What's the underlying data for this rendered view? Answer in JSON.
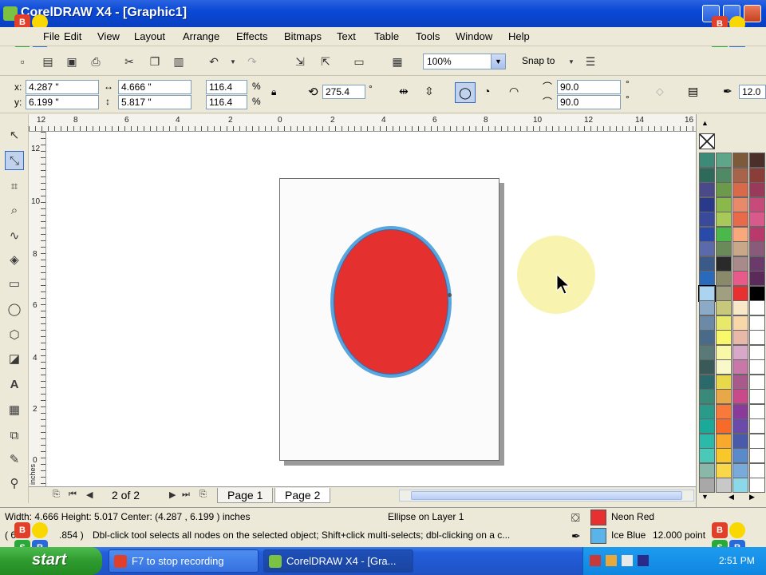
{
  "window": {
    "title": "CorelDRAW X4 - [Graphic1]"
  },
  "menu": [
    "File",
    "Edit",
    "View",
    "Layout",
    "Arrange",
    "Effects",
    "Bitmaps",
    "Text",
    "Table",
    "Tools",
    "Window",
    "Help"
  ],
  "toolbar": {
    "zoom": "100%",
    "snap_to": "Snap to"
  },
  "property_bar": {
    "x_label": "x:",
    "x": "4.287 \"",
    "y_label": "y:",
    "y": "6.199 \"",
    "width": "4.666 \"",
    "height": "5.817 \"",
    "scale_x": "116.4",
    "scale_y": "116.4",
    "percent": "%",
    "rotation": "275.4",
    "rotation_unit": "°",
    "start_angle": "90.0",
    "end_angle": "90.0",
    "angle_unit": "°",
    "outline_width": "12.0"
  },
  "ruler": {
    "top": [
      "12",
      "8",
      "6",
      "4",
      "2",
      "0",
      "2",
      "4",
      "6",
      "8",
      "10",
      "12",
      "14",
      "16"
    ],
    "left": [
      "12",
      "10",
      "8",
      "6",
      "4",
      "2",
      "0"
    ],
    "unit": "inches"
  },
  "page_nav": {
    "count": "2 of 2",
    "tabs": [
      "Page 1",
      "Page 2"
    ],
    "active_tab": 1
  },
  "status": {
    "dimensions": "Width: 4.666  Height: 5.017  Center: (4.287 , 6.199 )  inches",
    "object": "Ellipse on Layer 1",
    "coords": "( 6",
    "coords_tail": ".854 )",
    "hint": "Dbl-click tool selects all nodes on the selected object; Shift+click multi-selects; dbl-clicking on a c...",
    "fill_name": "Neon Red",
    "fill_color": "#e83030",
    "outline_name": "Ice Blue",
    "outline_color": "#5ab4ea",
    "outline_width_text": "12.000 point"
  },
  "taskbar": {
    "start": "start",
    "tasks": [
      "F7 to stop recording",
      "CorelDRAW X4 - [Gra..."
    ],
    "clock": "2:51 PM"
  },
  "recorder_badge": {
    "b": "B",
    "s": "S",
    "r": "R"
  },
  "palette_colors": [
    [
      "#3b8b78",
      "#5fa58a",
      "#7c5a3a",
      "#4a2f2a"
    ],
    [
      "#2d6a5a",
      "#4f8a64",
      "#a8644a",
      "#8a3e3a"
    ],
    [
      "#4a4a8a",
      "#6a9a4a",
      "#d86a4a",
      "#9a3a5a"
    ],
    [
      "#2a3a8a",
      "#8ab84a",
      "#e88a6a",
      "#c84a7a"
    ],
    [
      "#3a4a9a",
      "#a8c85a",
      "#e86a4a",
      "#d85a8a"
    ],
    [
      "#2a4aaa",
      "#4ab84a",
      "#f8a87a",
      "#b83a6a"
    ],
    [
      "#5a6aaa",
      "#6a8a5a",
      "#c8a888",
      "#8a5a7a"
    ],
    [
      "#3a5a8a",
      "#2a2a2a",
      "#a88a8a",
      "#6a3a6a"
    ],
    [
      "#2a6aba",
      "#8a8a6a",
      "#e85a8a",
      "#5a2a5a"
    ],
    [
      "#aad4f0",
      "#a0a080",
      "#e83030",
      "#000000"
    ],
    [
      "#8aaac8",
      "#c8c87a",
      "#f8e8c8",
      "#ffffff"
    ],
    [
      "#6a8aa8",
      "#e8e86a",
      "#f8d8a8",
      "#ffffff"
    ],
    [
      "#4a6a8a",
      "#f8f86a",
      "#e8b8a8",
      "#ffffff"
    ],
    [
      "#5a7a7a",
      "#f8f8a8",
      "#d8a8c8",
      "#ffffff"
    ],
    [
      "#3a5a5a",
      "#f8f8c8",
      "#c878a8",
      "#ffffff"
    ],
    [
      "#2a6a6a",
      "#e8d84a",
      "#a85a8a",
      "#ffffff"
    ],
    [
      "#3a8a7a",
      "#e8a84a",
      "#c84a8a",
      "#ffffff"
    ],
    [
      "#2a9a8a",
      "#f87a3a",
      "#8a3a9a",
      "#ffffff"
    ],
    [
      "#1aaa9a",
      "#f86a2a",
      "#6a4aaa",
      "#ffffff"
    ],
    [
      "#2abaaa",
      "#f8a82a",
      "#4a5aaa",
      "#ffffff"
    ],
    [
      "#4ac8b8",
      "#f8c82a",
      "#5a8aca",
      "#ffffff"
    ],
    [
      "#8ab8a8",
      "#f8d84a",
      "#7aaada",
      "#ffffff"
    ],
    [
      "#a8a8a8",
      "#c8c8c8",
      "#8ad8e8",
      "#ffffff"
    ]
  ]
}
